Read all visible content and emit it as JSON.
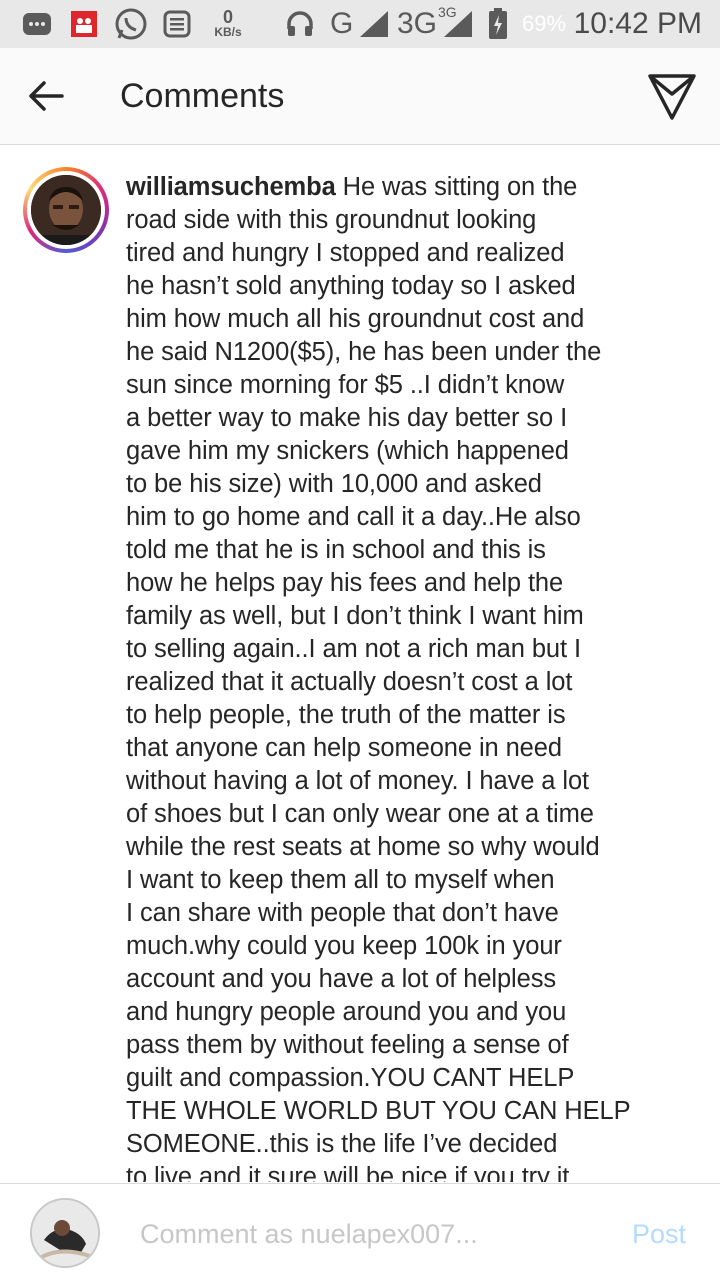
{
  "status_bar": {
    "data_speed_value": "0",
    "data_speed_unit": "KB/s",
    "network_2g": "G",
    "network_3g": "3G",
    "network_3g_small": "3G",
    "battery": "69%",
    "time": "10:42 PM",
    "icons": [
      "message-icon",
      "notification-icon",
      "whatsapp-icon",
      "news-icon",
      "headphones-icon",
      "signal-icon",
      "battery-icon"
    ]
  },
  "header": {
    "title": "Comments",
    "back_icon": "back-arrow-icon",
    "send_icon": "send-icon"
  },
  "comment": {
    "username": "williamsuchemba",
    "text": " He was sitting on the\nroad side with this groundnut looking\ntired and hungry I stopped and realized\nhe hasn’t sold anything today so I asked\nhim how much all his groundnut cost and\nhe said N1200($5), he has been under the\nsun since morning for $5 ..I didn’t know\na better way to make his day better so I\ngave him my snickers (which happened\nto be his size) with 10,000 and asked\nhim to go home and call it a day..He also\ntold me that he is in school and this is\nhow he helps pay his fees and help the\nfamily as well, but I don’t think I want him\nto selling again..I am not a rich man but I\nrealized that it actually doesn’t cost a lot\nto help people, the truth of the matter is\nthat anyone can help someone in need\nwithout having a lot of money. I have a lot\nof shoes but I can only wear one at a time\nwhile the rest seats at home so why would\nI want to keep them all to myself when\nI can share with people that don’t  have\nmuch.why could you keep 100k  in your\naccount and you have a lot of helpless\nand hungry people around you and you\npass them by without feeling a sense of\nguilt and compassion.YOU CANT HELP\nTHE WHOLE WORLD BUT YOU CAN HELP\nSOMEONE..this is the life I’ve decided\nto live and it sure will be nice if you try it"
  },
  "composer": {
    "placeholder": "Comment as nuelapex007...",
    "post_label": "Post"
  },
  "colors": {
    "status_bar_bg": "#e8e8e8",
    "header_bg": "#fafafa",
    "text": "#262626",
    "post_disabled": "#b3dbff",
    "placeholder": "#c7c7c7"
  }
}
